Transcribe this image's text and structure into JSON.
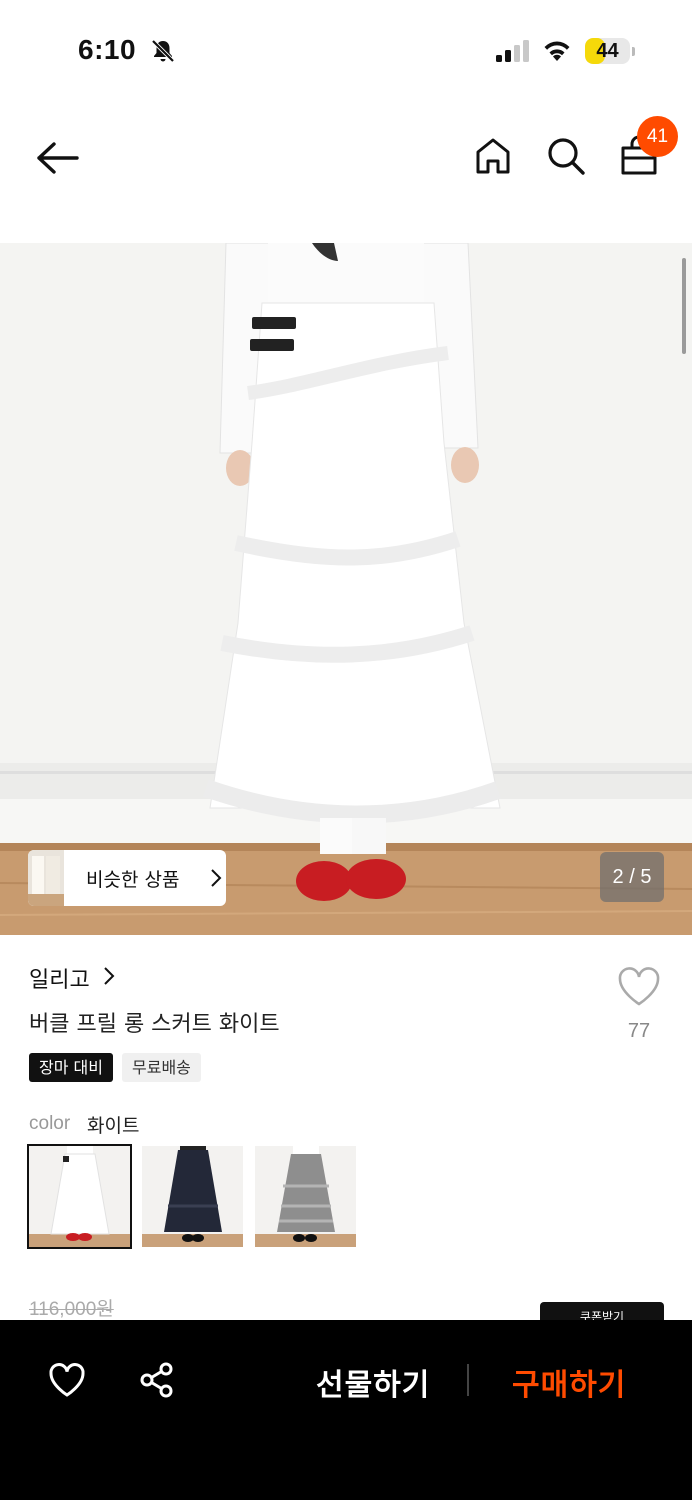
{
  "status_bar": {
    "time": "6:10",
    "battery": "44",
    "battery_level": 0.44
  },
  "nav": {
    "cart_count": "41",
    "icons": [
      "back-arrow-icon",
      "home-icon",
      "search-icon",
      "shopping-bag-icon"
    ]
  },
  "gallery": {
    "similar_label": "비슷한 상품",
    "pager": "2 / 5"
  },
  "product": {
    "brand": "일리고",
    "name": "버클 프릴 롱 스커트 화이트",
    "likes": "77",
    "tags": [
      "장마 대비",
      "무료배송"
    ],
    "color_label": "color",
    "color_value": "화이트",
    "color_options": [
      "white",
      "navy",
      "gray-check"
    ],
    "old_price": "116,000원",
    "coupon_label": "쿠폰받기"
  },
  "bottom_bar": {
    "gift_label": "선물하기",
    "buy_label": "구매하기",
    "accent": "#ff4b00"
  }
}
